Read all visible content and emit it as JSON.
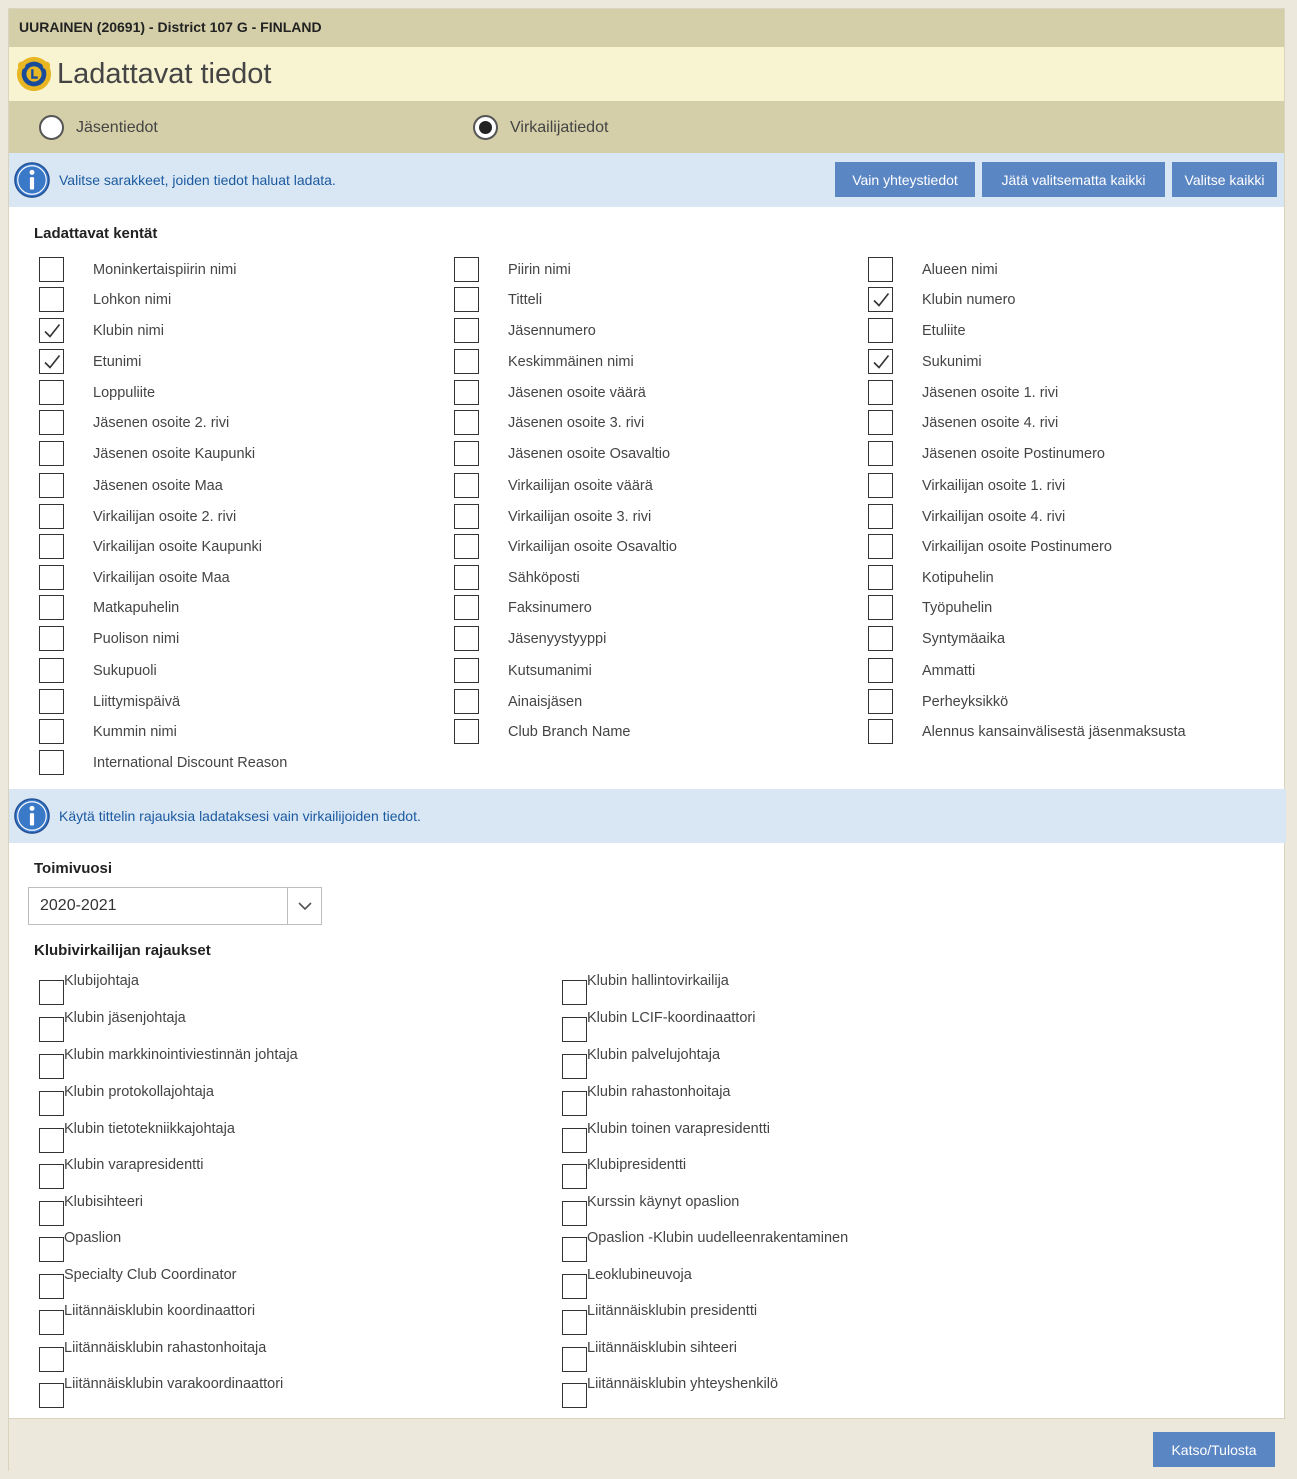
{
  "club_header": "UURAINEN (20691) - District 107 G - FINLAND",
  "page_title": "Ladattavat tiedot",
  "radio": {
    "member": "Jäsentiedot",
    "officer": "Virkailijatiedot",
    "selected": "officer"
  },
  "info1": "Valitse sarakkeet, joiden tiedot haluat ladata.",
  "buttons": {
    "contact_only": "Vain yhteystiedot",
    "deselect_all": "Jätä valitsematta kaikki",
    "select_all": "Valitse kaikki",
    "view_print": "Katso/Tulosta"
  },
  "fields_heading": "Ladattavat kentät",
  "fields": [
    {
      "label": "Moninkertaispiirin nimi",
      "checked": false
    },
    {
      "label": "Piirin nimi",
      "checked": false
    },
    {
      "label": "Alueen nimi",
      "checked": false
    },
    {
      "label": "Lohkon nimi",
      "checked": false
    },
    {
      "label": "Titteli",
      "checked": false
    },
    {
      "label": "Klubin numero",
      "checked": true
    },
    {
      "label": "Klubin nimi",
      "checked": true
    },
    {
      "label": "Jäsennumero",
      "checked": false
    },
    {
      "label": "Etuliite",
      "checked": false
    },
    {
      "label": "Etunimi",
      "checked": true
    },
    {
      "label": "Keskimmäinen nimi",
      "checked": false
    },
    {
      "label": "Sukunimi",
      "checked": true
    },
    {
      "label": "Loppuliite",
      "checked": false
    },
    {
      "label": "Jäsenen osoite väärä",
      "checked": false
    },
    {
      "label": "Jäsenen osoite 1. rivi",
      "checked": false
    },
    {
      "label": "Jäsenen osoite 2. rivi",
      "checked": false
    },
    {
      "label": "Jäsenen osoite 3. rivi",
      "checked": false
    },
    {
      "label": "Jäsenen osoite 4. rivi",
      "checked": false
    },
    {
      "label": "Jäsenen osoite Kaupunki",
      "checked": false
    },
    {
      "label": "Jäsenen osoite Osavaltio",
      "checked": false
    },
    {
      "label": "Jäsenen osoite Postinumero",
      "checked": false
    },
    {
      "label": "Jäsenen osoite Maa",
      "checked": false
    },
    {
      "label": "Virkailijan osoite väärä",
      "checked": false
    },
    {
      "label": "Virkailijan osoite 1. rivi",
      "checked": false
    },
    {
      "label": "Virkailijan osoite 2. rivi",
      "checked": false
    },
    {
      "label": "Virkailijan osoite 3. rivi",
      "checked": false
    },
    {
      "label": "Virkailijan osoite 4. rivi",
      "checked": false
    },
    {
      "label": "Virkailijan osoite Kaupunki",
      "checked": false
    },
    {
      "label": "Virkailijan osoite Osavaltio",
      "checked": false
    },
    {
      "label": "Virkailijan osoite Postinumero",
      "checked": false
    },
    {
      "label": "Virkailijan osoite Maa",
      "checked": false
    },
    {
      "label": "Sähköposti",
      "checked": false
    },
    {
      "label": "Kotipuhelin",
      "checked": false
    },
    {
      "label": "Matkapuhelin",
      "checked": false
    },
    {
      "label": "Faksinumero",
      "checked": false
    },
    {
      "label": "Työpuhelin",
      "checked": false
    },
    {
      "label": "Puolison nimi",
      "checked": false
    },
    {
      "label": "Jäsenyystyyppi",
      "checked": false
    },
    {
      "label": "Syntymäaika",
      "checked": false
    },
    {
      "label": "Sukupuoli",
      "checked": false
    },
    {
      "label": "Kutsumanimi",
      "checked": false
    },
    {
      "label": "Ammatti",
      "checked": false
    },
    {
      "label": "Liittymispäivä",
      "checked": false
    },
    {
      "label": "Ainaisjäsen",
      "checked": false
    },
    {
      "label": "Perheyksikkö",
      "checked": false
    },
    {
      "label": "Kummin nimi",
      "checked": false
    },
    {
      "label": "Club Branch Name",
      "checked": false
    },
    {
      "label": "Alennus kansainvälisestä jäsenmaksusta",
      "checked": false
    },
    {
      "label": "International Discount Reason",
      "checked": false
    }
  ],
  "info2": "Käytä tittelin rajauksia ladataksesi vain virkailijoiden tiedot.",
  "year_label": "Toimivuosi",
  "year_value": "2020-2021",
  "officer_heading": "Klubivirkailijan rajaukset",
  "officer_filters": [
    "Klubijohtaja",
    "Klubin hallintovirkailija",
    "Klubin jäsenjohtaja",
    "Klubin LCIF-koordinaattori",
    "Klubin markkinointiviestinnän johtaja",
    "Klubin palvelujohtaja",
    "Klubin protokollajohtaja",
    "Klubin rahastonhoitaja",
    "Klubin tietotekniikkajohtaja",
    "Klubin toinen varapresidentti",
    "Klubin varapresidentti",
    "Klubipresidentti",
    "Klubisihteeri",
    "Kurssin käynyt opaslion",
    "Opaslion",
    "Opaslion -Klubin uudelleenrakentaminen",
    "Specialty Club Coordinator",
    "Leoklubineuvoja",
    "Liitännäisklubin koordinaattori",
    "Liitännäisklubin presidentti",
    "Liitännäisklubin rahastonhoitaja",
    "Liitännäisklubin sihteeri",
    "Liitännäisklubin varakoordinaattori",
    "Liitännäisklubin yhteyshenkilö"
  ],
  "colors": {
    "header_bar": "#d4cfa8",
    "title_bar": "#f8f4d2",
    "info_bar": "#d9e7f4",
    "button": "#5b86c4",
    "info_text": "#1c5aa0"
  }
}
